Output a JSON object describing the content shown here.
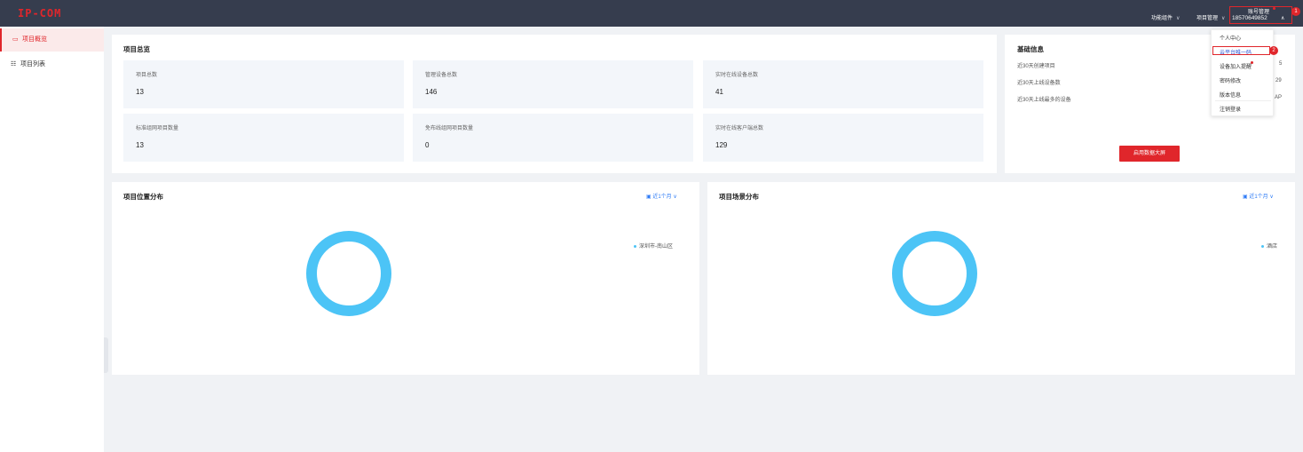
{
  "header": {
    "logo": "IP-COM",
    "nav": [
      {
        "label": "功能组件"
      },
      {
        "label": "项目管理"
      }
    ],
    "account": {
      "label": "账号管理",
      "phone": "18570649852"
    },
    "badges": [
      "1",
      "2"
    ]
  },
  "sidebar": {
    "items": [
      {
        "label": "项目概览",
        "icon": "monitor-icon",
        "active": true
      },
      {
        "label": "项目列表",
        "icon": "list-icon",
        "active": false
      }
    ]
  },
  "overview": {
    "title": "项目总览",
    "stats": [
      {
        "label": "项目总数",
        "value": "13"
      },
      {
        "label": "管理设备总数",
        "value": "146"
      },
      {
        "label": "实时在线设备总数",
        "value": "41"
      },
      {
        "label": "标准组网项目数量",
        "value": "13"
      },
      {
        "label": "免布线组网项目数量",
        "value": "0"
      },
      {
        "label": "实时在线客户端总数",
        "value": "129"
      }
    ]
  },
  "basic_info": {
    "title": "基础信息",
    "rows": [
      {
        "label": "近30天创建项目",
        "value": "5"
      },
      {
        "label": "近30天上线设备数",
        "value": "29"
      },
      {
        "label": "近30天上线最多的设备",
        "value": "AP"
      }
    ],
    "button": "启用数据大屏"
  },
  "location_chart": {
    "title": "项目位置分布",
    "period": "近1个月",
    "legend": "深圳市-南山区"
  },
  "scene_chart": {
    "title": "项目场景分布",
    "period": "近1个月",
    "legend": "酒店"
  },
  "account_menu": {
    "items": [
      "个人中心",
      "云平台唯一码",
      "设备加入提醒",
      "密码修改",
      "版本信息",
      "注销登录"
    ]
  },
  "colors": {
    "brand": "#e0262b",
    "header_bg": "#363d4e",
    "donut": "#4cc4f6",
    "link": "#2f7cf6"
  }
}
